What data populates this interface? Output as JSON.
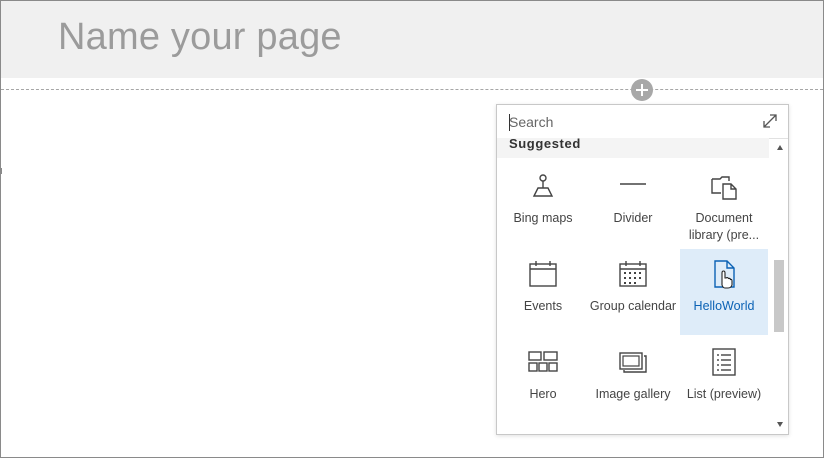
{
  "page": {
    "title": "Name your page"
  },
  "toolbox": {
    "search_placeholder": "Search",
    "section_label": "Suggested",
    "items": [
      {
        "label": "Bing maps",
        "icon": "map-pin-icon"
      },
      {
        "label": "Divider",
        "icon": "divider-icon"
      },
      {
        "label": "Document library (pre...",
        "icon": "document-library-icon"
      },
      {
        "label": "Events",
        "icon": "calendar-icon"
      },
      {
        "label": "Group calendar",
        "icon": "group-calendar-icon"
      },
      {
        "label": "HelloWorld",
        "icon": "document-icon",
        "selected": true
      },
      {
        "label": "Hero",
        "icon": "hero-layout-icon"
      },
      {
        "label": "Image gallery",
        "icon": "image-gallery-icon"
      },
      {
        "label": "List (preview)",
        "icon": "list-icon"
      }
    ]
  },
  "colors": {
    "selected_tile": "#deecf9",
    "selected_text": "#0b62b5",
    "title_band": "#f0f0f0"
  }
}
